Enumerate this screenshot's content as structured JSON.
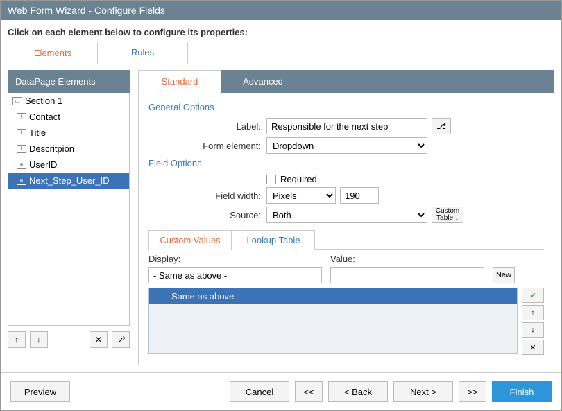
{
  "window": {
    "title": "Web Form Wizard - Configure Fields"
  },
  "instructions": "Click on each element below to configure its properties:",
  "outer_tabs": {
    "elements": "Elements",
    "rules": "Rules"
  },
  "dp": {
    "header": "DataPage Elements",
    "section": "Section 1",
    "items": [
      {
        "label": "Contact",
        "glyph": "t"
      },
      {
        "label": "Title",
        "glyph": "t"
      },
      {
        "label": "Descritpion",
        "glyph": "t"
      },
      {
        "label": "UserID",
        "glyph": "≡"
      },
      {
        "label": "Next_Step_User_ID",
        "glyph": "≡"
      }
    ]
  },
  "inner_tabs": {
    "standard": "Standard",
    "advanced": "Advanced"
  },
  "sections": {
    "general": "General Options",
    "field_opts": "Field Options"
  },
  "labels": {
    "label": "Label:",
    "form_element": "Form element:",
    "required": "Required",
    "field_width": "Field width:",
    "source": "Source:",
    "display": "Display:",
    "value": "Value:"
  },
  "values": {
    "label_value": "Responsible for the next step",
    "form_element_value": "Dropdown",
    "field_width_unit": "Pixels",
    "field_width_value": "190",
    "source_value": "Both",
    "custom_table_btn": "Custom Table ↓",
    "display_value": "- Same as above -",
    "value_value": "",
    "list_row": "- Same as above -"
  },
  "sub_tabs": {
    "custom": "Custom Values",
    "lookup": "Lookup Table"
  },
  "val_buttons": {
    "new": "New",
    "check": "✔",
    "up": "↑",
    "down": "↓",
    "delete": "✕"
  },
  "left_toolbar": {
    "up": "↑",
    "down": "↓",
    "delete": "✕",
    "branch": "⎇"
  },
  "footer": {
    "preview": "Preview",
    "cancel": "Cancel",
    "first": "<<",
    "back": "< Back",
    "next": "Next >",
    "last": ">>",
    "finish": "Finish"
  }
}
